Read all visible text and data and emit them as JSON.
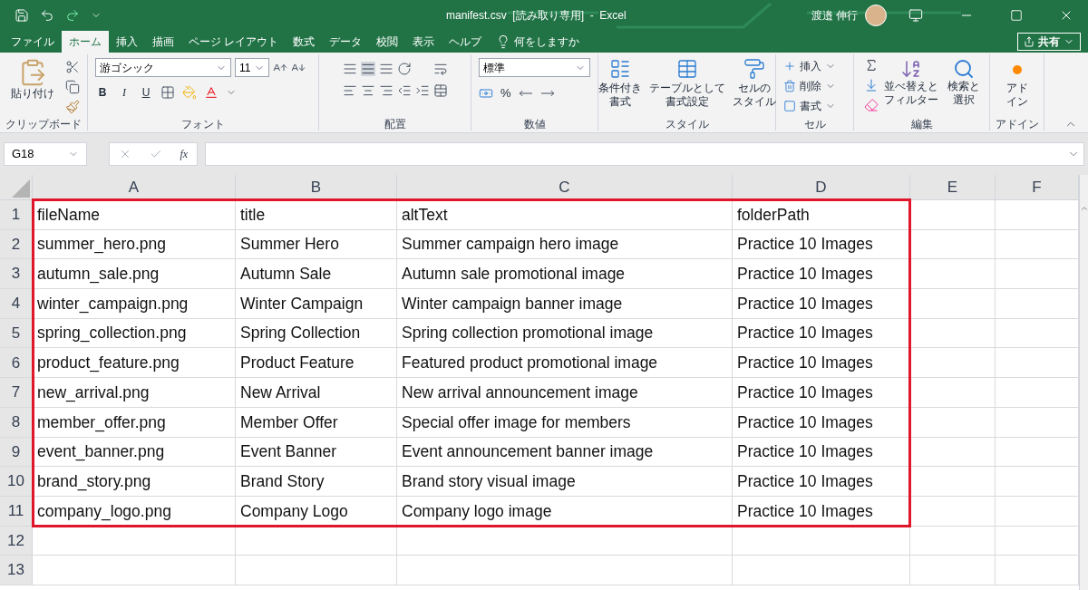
{
  "title_bar": {
    "title": "manifest.csv  [読み取り専用]  -  Excel",
    "user": "渡邉 伸行"
  },
  "tabs": [
    {
      "label": "ファイル",
      "selected": false
    },
    {
      "label": "ホーム",
      "selected": true
    },
    {
      "label": "挿入",
      "selected": false
    },
    {
      "label": "描画",
      "selected": false
    },
    {
      "label": "ページ レイアウト",
      "selected": false
    },
    {
      "label": "数式",
      "selected": false
    },
    {
      "label": "データ",
      "selected": false
    },
    {
      "label": "校閲",
      "selected": false
    },
    {
      "label": "表示",
      "selected": false
    },
    {
      "label": "ヘルプ",
      "selected": false
    }
  ],
  "tell_me": "何をしますか",
  "share": "共有",
  "ribbon": {
    "groups": [
      {
        "kind": "clipboard",
        "label": "クリップボード",
        "buttons": [
          {
            "lines": [
              "貼り付け"
            ]
          }
        ]
      },
      {
        "kind": "font",
        "label": "フォント",
        "font_name": "游ゴシック",
        "font_size": "11",
        "buttons": [
          "B",
          "I",
          "U"
        ]
      },
      {
        "kind": "alignment",
        "label": "配置"
      },
      {
        "kind": "number",
        "label": "数値",
        "format": "標準",
        "buttons": [
          "%"
        ]
      },
      {
        "kind": "styles",
        "label": "スタイル",
        "buttons": [
          {
            "lines": [
              "条件付き",
              "書式"
            ]
          },
          {
            "lines": [
              "テーブルとして",
              "書式設定"
            ]
          },
          {
            "lines": [
              "セルの",
              "スタイル"
            ]
          }
        ]
      },
      {
        "kind": "cells",
        "label": "セル",
        "buttons": [
          "挿入",
          "削除",
          "書式"
        ]
      },
      {
        "kind": "editing",
        "label": "編集",
        "buttons": [
          {
            "lines": [
              "並べ替えと",
              "フィルター"
            ]
          },
          {
            "lines": [
              "検索と",
              "選択"
            ]
          }
        ]
      },
      {
        "kind": "addins",
        "label": "アドイン",
        "buttons": [
          {
            "lines": [
              "アド",
              "イン"
            ]
          }
        ]
      }
    ]
  },
  "formula_bar": {
    "name_box": "G18",
    "fx": "fx"
  },
  "sheet": {
    "columns": [
      "A",
      "B",
      "C",
      "D",
      "E",
      "F"
    ],
    "rows": [
      {
        "number": "1",
        "cells": [
          "fileName",
          "title",
          "altText",
          "folderPath"
        ]
      },
      {
        "number": "2",
        "cells": [
          "summer_hero.png",
          "Summer Hero",
          "Summer campaign hero image",
          "Practice 10 Images"
        ]
      },
      {
        "number": "3",
        "cells": [
          "autumn_sale.png",
          "Autumn Sale",
          "Autumn sale promotional image",
          "Practice 10 Images"
        ]
      },
      {
        "number": "4",
        "cells": [
          "winter_campaign.png",
          "Winter Campaign",
          "Winter campaign banner image",
          "Practice 10 Images"
        ]
      },
      {
        "number": "5",
        "cells": [
          "spring_collection.png",
          "Spring Collection",
          "Spring collection promotional image",
          "Practice 10 Images"
        ]
      },
      {
        "number": "6",
        "cells": [
          "product_feature.png",
          "Product Feature",
          "Featured product promotional image",
          "Practice 10 Images"
        ]
      },
      {
        "number": "7",
        "cells": [
          "new_arrival.png",
          "New Arrival",
          "New arrival announcement image",
          "Practice 10 Images"
        ]
      },
      {
        "number": "8",
        "cells": [
          "member_offer.png",
          "Member Offer",
          "Special offer image for members",
          "Practice 10 Images"
        ]
      },
      {
        "number": "9",
        "cells": [
          "event_banner.png",
          "Event Banner",
          "Event announcement banner image",
          "Practice 10 Images"
        ]
      },
      {
        "number": "10",
        "cells": [
          "brand_story.png",
          "Brand Story",
          "Brand story visual image",
          "Practice 10 Images"
        ]
      },
      {
        "number": "11",
        "cells": [
          "company_logo.png",
          "Company Logo",
          "Company logo image",
          "Practice 10 Images"
        ]
      },
      {
        "number": "12",
        "cells": []
      },
      {
        "number": "13",
        "cells": []
      }
    ]
  }
}
